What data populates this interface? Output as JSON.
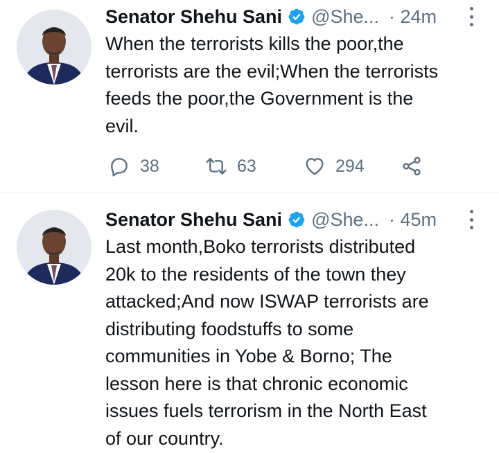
{
  "tweets": [
    {
      "author_name": "Senator Shehu Sani",
      "handle": "@She...",
      "time": "· 24m",
      "text": "When the terrorists kills the poor,the\nterrorists are the evil;When the terrorists\nfeeds the poor,the Government is the\nevil.",
      "replies": "38",
      "retweets": "63",
      "likes": "294"
    },
    {
      "author_name": "Senator Shehu Sani",
      "handle": "@She...",
      "time": "· 45m",
      "text": "Last month,Boko terrorists distributed\n20k to the residents of the town they\nattacked;And now ISWAP terrorists are\ndistributing foodstuffs to some\ncommunities in Yobe & Borno; The\nlesson here is that chronic economic\nissues fuels terrorism in the North East\nof our country."
    }
  ],
  "icons": {
    "verified": "verified-badge-icon",
    "more": "more-options-icon",
    "reply": "reply-icon",
    "retweet": "retweet-icon",
    "like": "like-icon",
    "share": "share-icon"
  },
  "colors": {
    "text": "#0f1419",
    "secondary": "#5b7083",
    "verified": "#1da1f2",
    "divider": "#e6e9ec"
  }
}
